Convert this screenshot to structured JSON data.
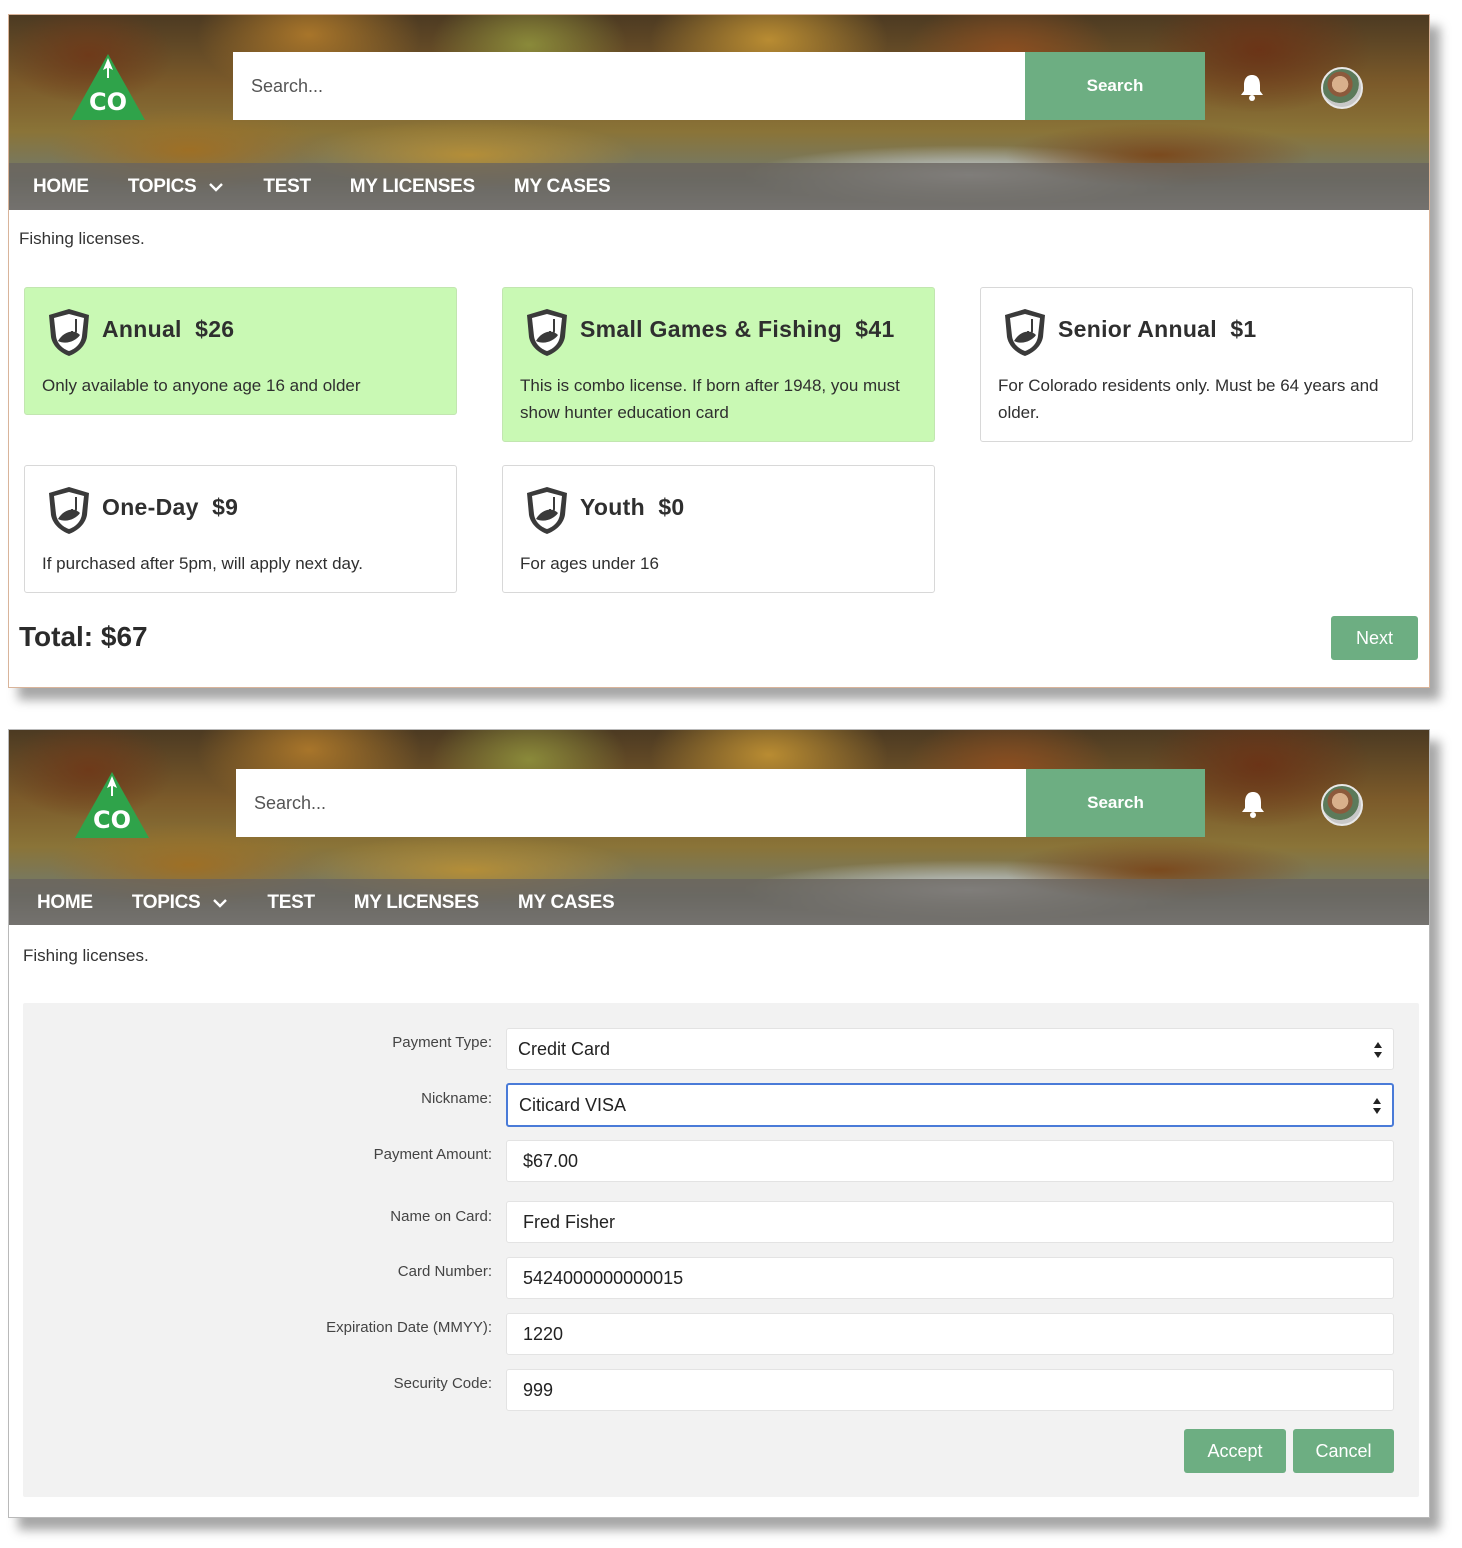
{
  "screens": [
    {
      "header": {
        "logo_text": "CO",
        "search_placeholder": "Search...",
        "search_button": "Search"
      },
      "nav": [
        "HOME",
        "TOPICS",
        "TEST",
        "MY LICENSES",
        "MY CASES"
      ],
      "caption": "Fishing licenses.",
      "cards": [
        {
          "title": "Annual  $26",
          "desc": "Only available to anyone age 16 and older",
          "selected": true
        },
        {
          "title": "Small Games & Fishing  $41",
          "desc": "This is combo license. If born after 1948, you must show hunter education card",
          "selected": true
        },
        {
          "title": "Senior Annual  $1",
          "desc": "For Colorado residents only. Must be 64 years and older.",
          "selected": false
        },
        {
          "title": "One-Day  $9",
          "desc": "If purchased after 5pm, will apply next day.",
          "selected": false
        },
        {
          "title": "Youth  $0",
          "desc": "For ages under 16",
          "selected": false
        }
      ],
      "total": "Total: $67",
      "next_button": "Next"
    },
    {
      "header": {
        "logo_text": "CO",
        "search_placeholder": "Search...",
        "search_button": "Search"
      },
      "nav": [
        "HOME",
        "TOPICS",
        "TEST",
        "MY LICENSES",
        "MY CASES"
      ],
      "caption": "Fishing licenses.",
      "form": {
        "payment_type": {
          "label": "Payment Type:",
          "value": "Credit Card"
        },
        "nickname": {
          "label": "Nickname:",
          "value": "Citicard VISA"
        },
        "payment_amount": {
          "label": "Payment Amount:",
          "value": "$67.00"
        },
        "name_on_card": {
          "label": "Name on Card:",
          "value": "Fred Fisher"
        },
        "card_number": {
          "label": "Card Number:",
          "value": "5424000000000015"
        },
        "expiration": {
          "label": "Expiration Date (MMYY):",
          "value": "1220"
        },
        "security_code": {
          "label": "Security Code:",
          "value": "999"
        }
      },
      "accept_button": "Accept",
      "cancel_button": "Cancel"
    }
  ],
  "colors": {
    "accent_green": "#6dae82",
    "selected_card": "#c9f9b4",
    "logo_green": "#2fa34a",
    "focus_blue": "#4a7bd8"
  },
  "icons": [
    "co-logo-icon",
    "bell-icon",
    "avatar",
    "chevron-down-icon",
    "shield-fish-icon",
    "select-arrows-icon"
  ]
}
